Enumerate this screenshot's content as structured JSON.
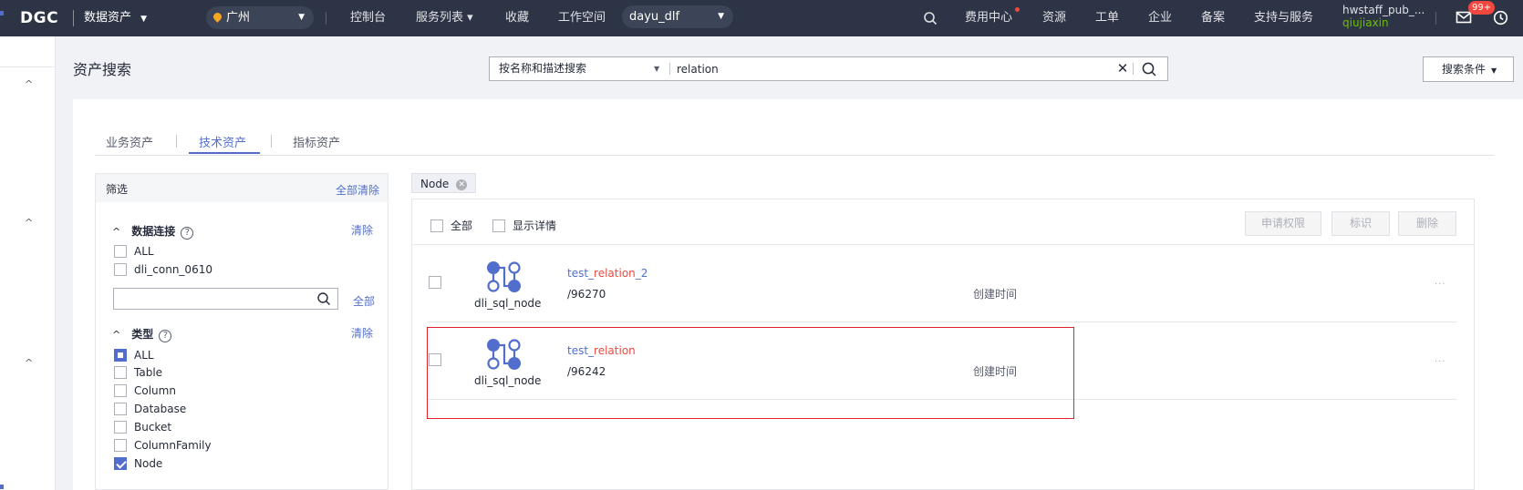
{
  "topbar": {
    "logo": "DGC",
    "product": "数据资产",
    "product_caret": "▼",
    "region": "广州",
    "caret": "▼",
    "nav": [
      "控制台",
      "服务列表 ▾",
      "收藏",
      "工作空间"
    ],
    "workspace": "dayu_dlf",
    "right_nav": [
      "费用中心",
      "资源",
      "工单",
      "企业",
      "备案",
      "支持与服务"
    ],
    "user_name": "hwstaff_pub_...",
    "user_sub": "qiujiaxin",
    "badge": "99+"
  },
  "rail": {
    "chevrons": [
      "^",
      "^",
      "^"
    ]
  },
  "page": {
    "title": "资产搜索",
    "search_scope": "按名称和描述搜索",
    "search_value": "relation",
    "clear_icon": "✕",
    "cond_button": "搜索条件"
  },
  "tabs": [
    "业务资产",
    "技术资产",
    "指标资产"
  ],
  "filter": {
    "title": "筛选",
    "clear_all": "全部清除",
    "group1": {
      "title": "数据连接",
      "clear": "清除",
      "options": [
        "ALL",
        "dli_conn_0610"
      ],
      "all_link": "全部"
    },
    "group2": {
      "title": "类型",
      "clear": "清除",
      "options": [
        "ALL",
        "Table",
        "Column",
        "Database",
        "Bucket",
        "ColumnFamily",
        "Node"
      ]
    },
    "help_glyph": "?",
    "chevron_glyph": "^"
  },
  "results": {
    "chip": "Node",
    "chip_x": "✕",
    "select_all": "全部",
    "show_detail": "显示详情",
    "buttons": [
      "申请权限",
      "标识",
      "删除"
    ],
    "rows": [
      {
        "prefix": "test_",
        "match": "relation",
        "suffix": "_2",
        "type": "dli_sql_node",
        "path": "/96270",
        "time_label": "创建时间",
        "more": "···"
      },
      {
        "prefix": "test_",
        "match": "relation",
        "suffix": "",
        "type": "dli_sql_node",
        "path": "/96242",
        "time_label": "创建时间",
        "more": "···"
      }
    ]
  },
  "colors": {
    "topbar": "#2d3445",
    "accent": "#526ecc",
    "highlight": "#f0483e",
    "annotation_box": "#e0202a"
  }
}
